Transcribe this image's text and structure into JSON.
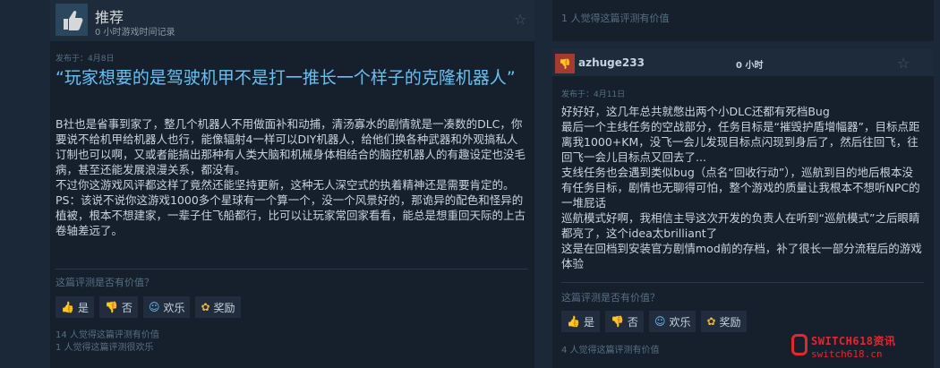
{
  "left": {
    "rec_label": "推荐",
    "hours": "0 小时游戏时间记录",
    "posted": "发布于：4月8日",
    "title": "“玩家想要的是驾驶机甲不是打一推长一个样子的克隆机器人”",
    "body": "B社也是省事到家了，整几个机器人不用做面补和动捕，清汤寡水的剧情就是一凑数的DLC，你要说不给机甲给机器人也行，能像辐射4一样可以DIY机器人，给他们换各种武器和外观搞私人订制也可以啊，又或者能搞出那种有人类大脑和机械身体相结合的脑控机器人的有趣设定也没毛病，甚至还能发展浪漫关系，都没有。\n不过你这游戏风评都这样了竟然还能坚持更新，这种无人深空式的执着精神还是需要肯定的。\nPS：该说不说你这游戏1000多个星球有一个算一个，没一个风景好的，那诡异的配色和怪异的植被，根本不想建家，一辈子住飞船都行，比可以让玩家常回家看看，能总是想重回天际的上古卷轴差远了。",
    "question": "这篇评测是否有价值？",
    "buttons": {
      "yes": "是",
      "no": "否",
      "funny": "欢乐",
      "award": "奖励"
    },
    "helpful_count": "14 人觉得这篇评测有价值",
    "funny_count": "1 人觉得这篇评测很欢乐"
  },
  "right_top": {
    "helpful_count": "1 人觉得这篇评测有价值"
  },
  "right": {
    "username": "azhuge233",
    "hours": "0 小时",
    "posted": "发布于：4月11日",
    "body": "好好好，这几年总共就憋出两个小DLC还都有死档Bug\n最后一个主线任务的空战部分，任务目标是“摧毁护盾增幅器”，目标点距离我1000+KM，没飞一会儿发现目标点闪现到身后了，然后往回飞，往回飞一会儿目标点又回去了...\n支线任务也会遇到类似bug（点名“回收行动”），巡航到目的地后根本没有任务目标，剧情也无聊得可怕，整个游戏的质量让我根本不想听NPC的一堆屁话\n巡航模式好啊，我相信主导这次开发的负责人在听到“巡航模式”之后眼睛都亮了，这个idea太brilliant了\n这是在回档到安装官方剧情mod前的存档，补了很长一部分流程后的游戏体验",
    "question": "这篇评测是否有价值？",
    "buttons": {
      "yes": "是",
      "no": "否",
      "funny": "欢乐",
      "award": "奖励"
    },
    "helpful_count": "4 人觉得这篇评测有价值"
  },
  "watermark": {
    "brand": "SWITCH618资讯",
    "url": "switch618.cn",
    "color": "#e4262d"
  },
  "icons": {
    "thumbs_up": "👍",
    "thumbs_down": "👎",
    "smile": "☺",
    "award": "✿",
    "star": "☆"
  }
}
